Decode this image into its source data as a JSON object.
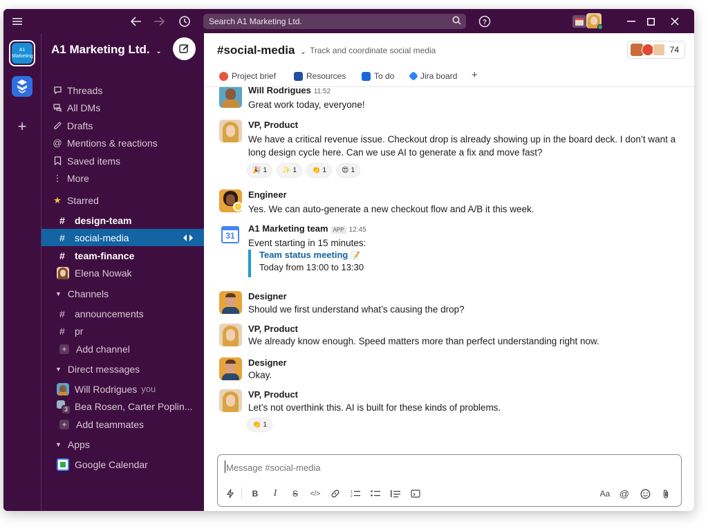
{
  "search": {
    "placeholder": "Search A1 Marketing Ltd."
  },
  "workspace": {
    "name": "A1 Marketing Ltd.",
    "tile_label": "A1 Marketing"
  },
  "sidebar": {
    "top_items": [
      {
        "label": "Threads",
        "icon": "threads-icon"
      },
      {
        "label": "All DMs",
        "icon": "dms-icon"
      },
      {
        "label": "Drafts",
        "icon": "drafts-icon"
      },
      {
        "label": "Mentions & reactions",
        "icon": "mentions-icon"
      },
      {
        "label": "Saved items",
        "icon": "bookmark-icon"
      },
      {
        "label": "More",
        "icon": "more-icon"
      }
    ],
    "starred_label": "Starred",
    "starred": [
      {
        "label": "design-team"
      },
      {
        "label": "social-media"
      },
      {
        "label": "team-finance"
      },
      {
        "label": "Elena Nowak"
      }
    ],
    "channels_label": "Channels",
    "channels": [
      {
        "label": "announcements"
      },
      {
        "label": "pr"
      }
    ],
    "add_channel": "Add channel",
    "dms_label": "Direct messages",
    "dms": [
      {
        "label": "Will Rodrigues",
        "suffix": "you"
      },
      {
        "label": "Bea Rosen, Carter Poplin...",
        "badge": "3"
      }
    ],
    "add_teammates": "Add teammates",
    "apps_label": "Apps",
    "apps": [
      {
        "label": "Google Calendar"
      }
    ]
  },
  "channel": {
    "title": "#social-media",
    "description": "Track and coordinate social media",
    "member_count": "74",
    "tabs": [
      {
        "label": "Project brief",
        "color": "#e8563f"
      },
      {
        "label": "Resources",
        "color": "#1f4fa3"
      },
      {
        "label": "To do",
        "color": "#1868db"
      },
      {
        "label": "Jira board",
        "color": "#2684ff"
      }
    ]
  },
  "messages": [
    {
      "author": "Will Rodrigues",
      "time": "11:52",
      "text": "Great work today, everyone!"
    },
    {
      "author": "VP, Product",
      "text": "We have a critical revenue issue. Checkout drop is already showing up in the board deck. I don’t want a long design cycle here. Can we use AI to generate a fix and move fast?",
      "reactions": [
        {
          "emoji": "🎉",
          "count": "1"
        },
        {
          "emoji": "✨",
          "count": "1"
        },
        {
          "emoji": "👏",
          "count": "1"
        },
        {
          "emoji": "😍",
          "count": "1"
        }
      ]
    },
    {
      "author": "Engineer",
      "text": "Yes. We can auto-generate a new checkout flow and A/B it this week."
    },
    {
      "author": "A1 Marketing team",
      "app_badge": "APP",
      "time": "12:45",
      "text": "Event starting in 15 minutes:",
      "event_title": "Team status meeting",
      "event_time": "Today from 13:00 to 13:30",
      "calendar_day": "31"
    },
    {
      "author": "Designer",
      "text": "Should we first understand what’s causing the drop?"
    },
    {
      "author": "VP, Product",
      "text": "We already know enough. Speed matters more than perfect understanding right now."
    },
    {
      "author": "Designer",
      "text": "Okay."
    },
    {
      "author": "VP, Product",
      "text": "Let’s not overthink this. AI is built for these kinds of problems.",
      "reactions": [
        {
          "emoji": "👏",
          "count": "1"
        }
      ]
    }
  ],
  "composer": {
    "placeholder": "Message #social-media",
    "format_aa": "Aa"
  }
}
